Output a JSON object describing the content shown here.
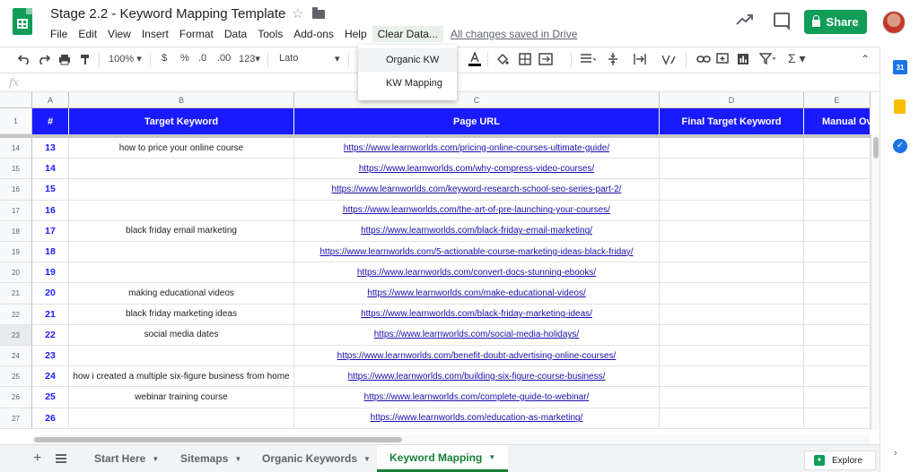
{
  "header": {
    "doc_title": "Stage 2.2 - Keyword Mapping Template",
    "star": "☆",
    "menus": [
      "File",
      "Edit",
      "View",
      "Insert",
      "Format",
      "Data",
      "Tools",
      "Add-ons",
      "Help",
      "Clear Data..."
    ],
    "save_status": "All changes saved in Drive",
    "share_label": "Share",
    "colors": {
      "brand_green": "#0f9d58",
      "header_blue": "#1a1aff"
    }
  },
  "toolbar": {
    "zoom": "100%",
    "currency": "$",
    "percent": "%",
    "dec_less": ".0",
    "dec_more": ".00",
    "format_more": "123",
    "font": "Lato",
    "icons": [
      "undo-icon",
      "redo-icon",
      "print-icon",
      "paint-format-icon",
      "text-color-icon",
      "fill-color-icon",
      "borders-icon",
      "merge-icon",
      "align-icon",
      "valign-icon",
      "wrap-icon",
      "rotate-icon",
      "link-icon",
      "comment-icon",
      "chart-icon",
      "filter-icon",
      "functions-icon",
      "collapse-icon"
    ]
  },
  "formula_bar": {
    "fx": "fx"
  },
  "dropdown": {
    "items": [
      "Organic KW",
      "KW Mapping"
    ]
  },
  "columns": [
    "A",
    "B",
    "C",
    "D",
    "E"
  ],
  "header_row": {
    "row_num": "1",
    "cells": [
      "#",
      "Target Keyword",
      "Page URL",
      "Final Target Keyword",
      "Manual Ove"
    ]
  },
  "rows": [
    {
      "row": "14",
      "num": "13",
      "kw": "how to price your online course",
      "url": "https://www.learnworlds.com/pricing-online-courses-ultimate-guide/"
    },
    {
      "row": "15",
      "num": "14",
      "kw": "",
      "url": "https://www.learnworlds.com/why-compress-video-courses/"
    },
    {
      "row": "16",
      "num": "15",
      "kw": "",
      "url": "https://www.learnworlds.com/keyword-research-school-seo-series-part-2/"
    },
    {
      "row": "17",
      "num": "16",
      "kw": "",
      "url": "https://www.learnworlds.com/the-art-of-pre-launching-your-courses/"
    },
    {
      "row": "18",
      "num": "17",
      "kw": "black friday email marketing",
      "url": "https://www.learnworlds.com/black-friday-email-marketing/"
    },
    {
      "row": "19",
      "num": "18",
      "kw": "",
      "url": "https://www.learnworlds.com/5-actionable-course-marketing-ideas-black-friday/"
    },
    {
      "row": "20",
      "num": "19",
      "kw": "",
      "url": "https://www.learnworlds.com/convert-docs-stunning-ebooks/"
    },
    {
      "row": "21",
      "num": "20",
      "kw": "making educational videos",
      "url": "https://www.learnworlds.com/make-educational-videos/"
    },
    {
      "row": "22",
      "num": "21",
      "kw": "black friday marketing ideas",
      "url": "https://www.learnworlds.com/black-friday-marketing-ideas/"
    },
    {
      "row": "23",
      "num": "22",
      "kw": "social media dates",
      "url": "https://www.learnworlds.com/social-media-holidays/"
    },
    {
      "row": "24",
      "num": "23",
      "kw": "",
      "url": "https://www.learnworlds.com/benefit-doubt-advertising-online-courses/"
    },
    {
      "row": "25",
      "num": "24",
      "kw": "how i created a multiple six-figure business from home",
      "url": "https://www.learnworlds.com/building-six-figure-course-business/"
    },
    {
      "row": "26",
      "num": "25",
      "kw": "webinar training course",
      "url": "https://www.learnworlds.com/complete-guide-to-webinar/"
    },
    {
      "row": "27",
      "num": "26",
      "kw": "",
      "url": "https://www.learnworlds.com/education-as-marketing/"
    }
  ],
  "sheet_tabs": [
    {
      "label": "Start Here",
      "active": false
    },
    {
      "label": "Sitemaps",
      "active": false
    },
    {
      "label": "Organic Keywords",
      "active": false
    },
    {
      "label": "Keyword Mapping",
      "active": true
    }
  ],
  "side_panel": {
    "calendar_label": "31"
  },
  "explore_label": "Explore"
}
